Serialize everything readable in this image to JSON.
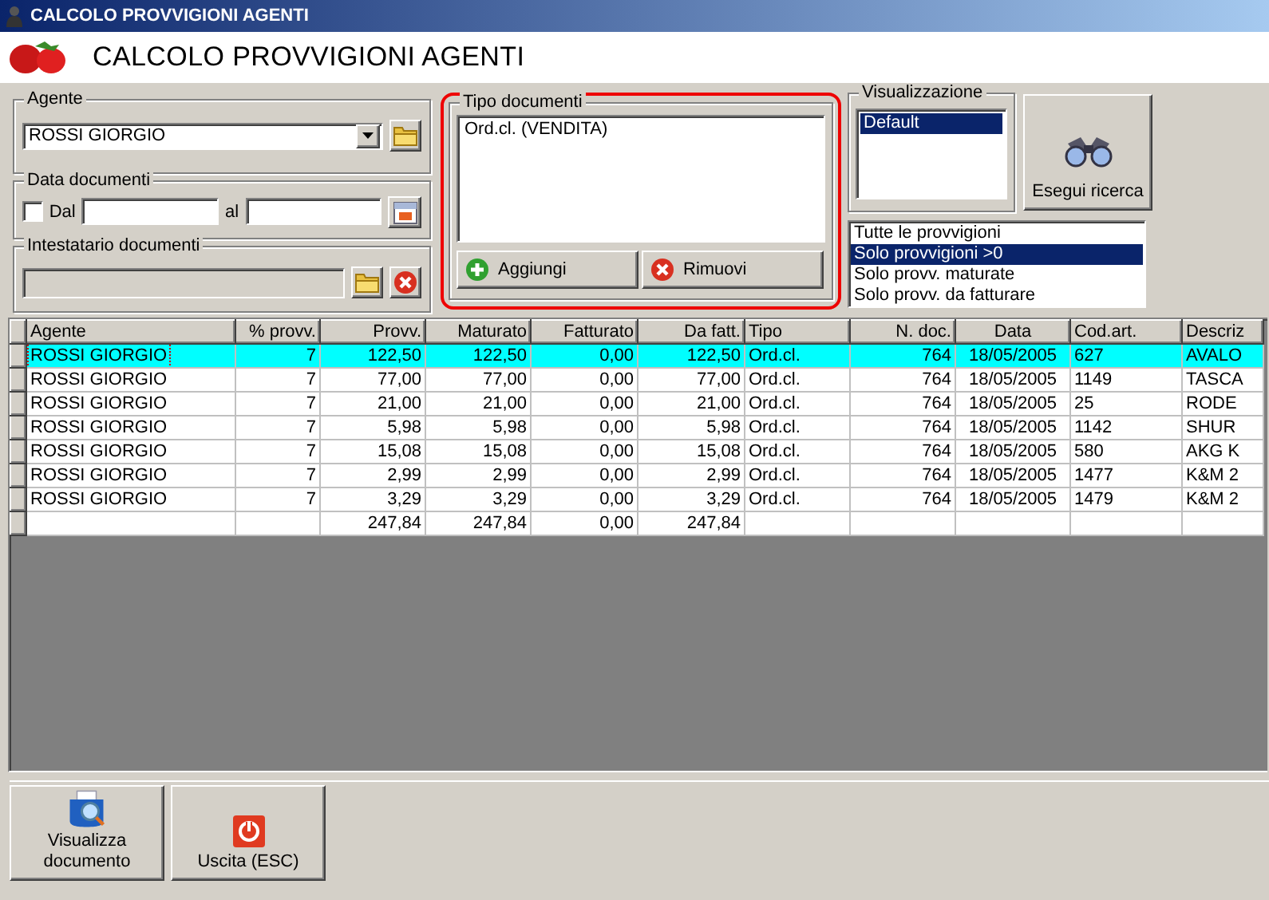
{
  "window": {
    "title": "CALCOLO PROVVIGIONI AGENTI"
  },
  "header": {
    "title": "CALCOLO PROVVIGIONI AGENTI"
  },
  "agente": {
    "label": "Agente",
    "value": "ROSSI GIORGIO"
  },
  "data_documenti": {
    "label": "Data documenti",
    "checkbox": {
      "label": "Dal",
      "checked": false
    },
    "to_label": "al"
  },
  "intestatario": {
    "label": "Intestatario documenti",
    "disabled": true
  },
  "tipo_documenti": {
    "label": "Tipo documenti",
    "highlighted": true,
    "items": [
      {
        "text": "Ord.cl. (VENDITA)",
        "selected": false
      }
    ],
    "buttons": [
      {
        "kind": "add",
        "label": "Aggiungi"
      },
      {
        "kind": "remove",
        "label": "Rimuovi"
      }
    ]
  },
  "visualizzazione": {
    "label": "Visualizzazione",
    "items": [
      {
        "text": "Default",
        "selected": true
      }
    ]
  },
  "search_button": {
    "label": "Esegui ricerca"
  },
  "filters": [
    {
      "text": "Tutte le provvigioni",
      "selected": false
    },
    {
      "text": "Solo provvigioni >0",
      "selected": true
    },
    {
      "text": "Solo provv. maturate",
      "selected": false
    },
    {
      "text": "Solo provv. da fatturare",
      "selected": false
    }
  ],
  "table": {
    "columns": [
      {
        "label": "Agente",
        "kind": "text"
      },
      {
        "label": "% provv.",
        "kind": "number"
      },
      {
        "label": "Provv.",
        "kind": "number"
      },
      {
        "label": "Maturato",
        "kind": "number"
      },
      {
        "label": "Fatturato",
        "kind": "number"
      },
      {
        "label": "Da fatt.",
        "kind": "number"
      },
      {
        "label": "Tipo",
        "kind": "text"
      },
      {
        "label": "N. doc.",
        "kind": "number"
      },
      {
        "label": "Data",
        "kind": "date"
      },
      {
        "label": "Cod.art.",
        "kind": "text"
      },
      {
        "label": "Descriz",
        "kind": "text"
      }
    ],
    "rows": [
      {
        "selected": true,
        "cells": [
          "ROSSI GIORGIO",
          "7",
          "122,50",
          "122,50",
          "0,00",
          "122,50",
          "Ord.cl.",
          "764",
          "18/05/2005",
          "627",
          "AVALO"
        ]
      },
      {
        "selected": false,
        "cells": [
          "ROSSI GIORGIO",
          "7",
          "77,00",
          "77,00",
          "0,00",
          "77,00",
          "Ord.cl.",
          "764",
          "18/05/2005",
          "1149",
          "TASCA"
        ]
      },
      {
        "selected": false,
        "cells": [
          "ROSSI GIORGIO",
          "7",
          "21,00",
          "21,00",
          "0,00",
          "21,00",
          "Ord.cl.",
          "764",
          "18/05/2005",
          "25",
          "RODE"
        ]
      },
      {
        "selected": false,
        "cells": [
          "ROSSI GIORGIO",
          "7",
          "5,98",
          "5,98",
          "0,00",
          "5,98",
          "Ord.cl.",
          "764",
          "18/05/2005",
          "1142",
          "SHUR"
        ]
      },
      {
        "selected": false,
        "cells": [
          "ROSSI GIORGIO",
          "7",
          "15,08",
          "15,08",
          "0,00",
          "15,08",
          "Ord.cl.",
          "764",
          "18/05/2005",
          "580",
          "AKG K"
        ]
      },
      {
        "selected": false,
        "cells": [
          "ROSSI GIORGIO",
          "7",
          "2,99",
          "2,99",
          "0,00",
          "2,99",
          "Ord.cl.",
          "764",
          "18/05/2005",
          "1477",
          "K&M 2"
        ]
      },
      {
        "selected": false,
        "cells": [
          "ROSSI GIORGIO",
          "7",
          "3,29",
          "3,29",
          "0,00",
          "3,29",
          "Ord.cl.",
          "764",
          "18/05/2005",
          "1479",
          "K&M 2"
        ]
      }
    ],
    "totals": {
      "provv": "247,84",
      "maturato": "247,84",
      "fatturato": "0,00",
      "da_fatt": "247,84"
    }
  },
  "toolbar": [
    {
      "kind": "view",
      "label": "Visualizza documento"
    },
    {
      "kind": "exit",
      "label": "Uscita (ESC)"
    }
  ]
}
